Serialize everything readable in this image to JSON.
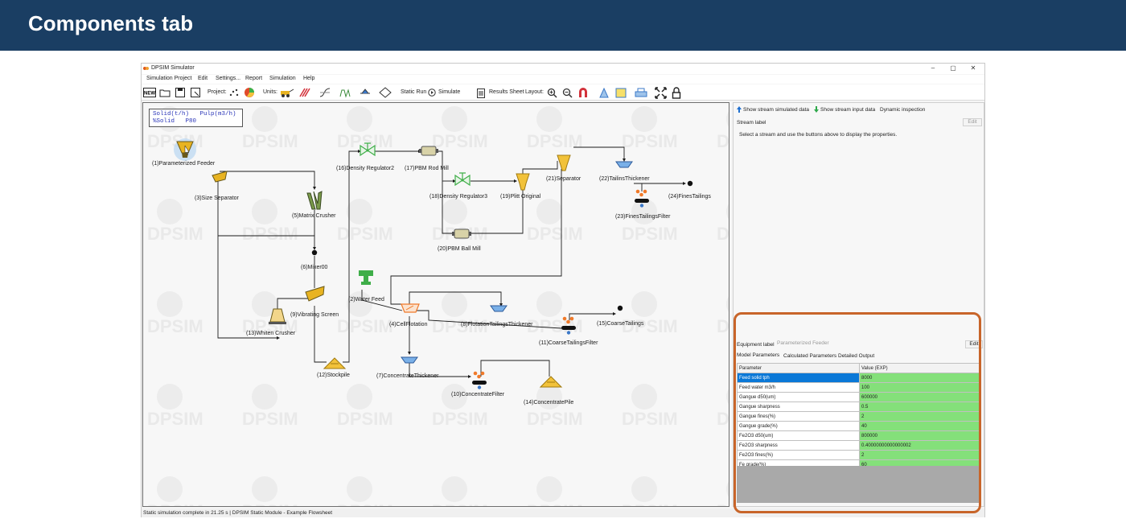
{
  "banner": {
    "title": "Components tab"
  },
  "window": {
    "title": "DPSIM Simulator",
    "minimize": "–",
    "maximize": "▢",
    "close": "✕"
  },
  "menu": [
    "Simulation Project",
    "Edit",
    "Settings...",
    "Report",
    "Simulation",
    "Help"
  ],
  "toolbar": {
    "project_label": "Project:",
    "units_label": "Units:",
    "static_run": "Static Run",
    "simulate": "Simulate",
    "results_sheet": "Results Sheet",
    "layout_label": "Layout:",
    "new_label": "NEW"
  },
  "legend": {
    "line1": "Solid(t/h)   Pulp(m3/h)",
    "line2": "%Solid   P80"
  },
  "units": [
    {
      "id": "u1",
      "label": "(1)Parameterized Feeder"
    },
    {
      "id": "u2",
      "label": "(2)Water Feed"
    },
    {
      "id": "u3",
      "label": "(3)Size Separator"
    },
    {
      "id": "u4",
      "label": "(4)CellFlotation"
    },
    {
      "id": "u5",
      "label": "(5)Matrix Crusher"
    },
    {
      "id": "u6",
      "label": "(6)Mixer00"
    },
    {
      "id": "u7",
      "label": "(7)ConcentrateThickener"
    },
    {
      "id": "u8",
      "label": "(8)FlotationTailingsThickener"
    },
    {
      "id": "u9",
      "label": "(9)Vibrating Screen"
    },
    {
      "id": "u10",
      "label": "(10)ConcentrateFilter"
    },
    {
      "id": "u11",
      "label": "(11)CoarseTailingsFilter"
    },
    {
      "id": "u12",
      "label": "(12)Stockpile"
    },
    {
      "id": "u13",
      "label": "(13)Whiten Crusher"
    },
    {
      "id": "u14",
      "label": "(14)ConcentratePile"
    },
    {
      "id": "u15",
      "label": "(15)CoarseTailings"
    },
    {
      "id": "u16",
      "label": "(16)Density Regulator2"
    },
    {
      "id": "u17",
      "label": "(17)PBM Rod Mill"
    },
    {
      "id": "u18",
      "label": "(18)Density Regulator3"
    },
    {
      "id": "u19",
      "label": "(19)Plitt Original"
    },
    {
      "id": "u20",
      "label": "(20)PBM Ball Mill"
    },
    {
      "id": "u21",
      "label": "(21)Separator"
    },
    {
      "id": "u22",
      "label": "(22)TailinsThickener"
    },
    {
      "id": "u23",
      "label": "(23)FinesTailingsFilter"
    },
    {
      "id": "u24",
      "label": "(24)FinesTailings"
    }
  ],
  "watermark": "DPSIM",
  "right_panel": {
    "show_simulated": "Show stream simulated data",
    "show_input": "Show stream input data",
    "dynamic_inspection": "Dynamic inspection",
    "stream_label": "Stream label",
    "edit_btn": "Edit",
    "hint": "Select a stream and use the buttons above to display the properties.",
    "equipment_label": "Equipment label",
    "equipment_name": "Parameterized Feeder",
    "edit_btn2": "Edit",
    "tabs": [
      "Model Parameters",
      "Calculated Parameters",
      "Detailed Output"
    ],
    "table_headers": [
      "Parameter",
      "Value (EXP)"
    ],
    "rows": [
      {
        "param": "Feed solid tph",
        "value": "8000"
      },
      {
        "param": "Feed water m3/h",
        "value": "100"
      },
      {
        "param": "Gangue d50(um)",
        "value": "600000"
      },
      {
        "param": "Gangue sharpness",
        "value": "0.5"
      },
      {
        "param": "Gangue fines(%)",
        "value": "2"
      },
      {
        "param": "Gangue grade(%)",
        "value": "40"
      },
      {
        "param": "Fe2O3 d50(um)",
        "value": "800000"
      },
      {
        "param": "Fe2O3 sharpness",
        "value": "0.40000000000000002"
      },
      {
        "param": "Fe2O3 fines(%)",
        "value": "2"
      },
      {
        "param": "Fe grade(%)",
        "value": "60"
      }
    ]
  },
  "status": {
    "text": "Static simulation complete in 21.25 s  |  DPSIM Static Module - Example Flowsheet"
  },
  "colors": {
    "banner": "#1a3e63",
    "highlight": "#c8652a",
    "value_cell": "#84e07a",
    "selected_row": "#0a78d7",
    "equipment": "#e8b321",
    "valve": "#3fae49",
    "thickener": "#3b78c8"
  }
}
